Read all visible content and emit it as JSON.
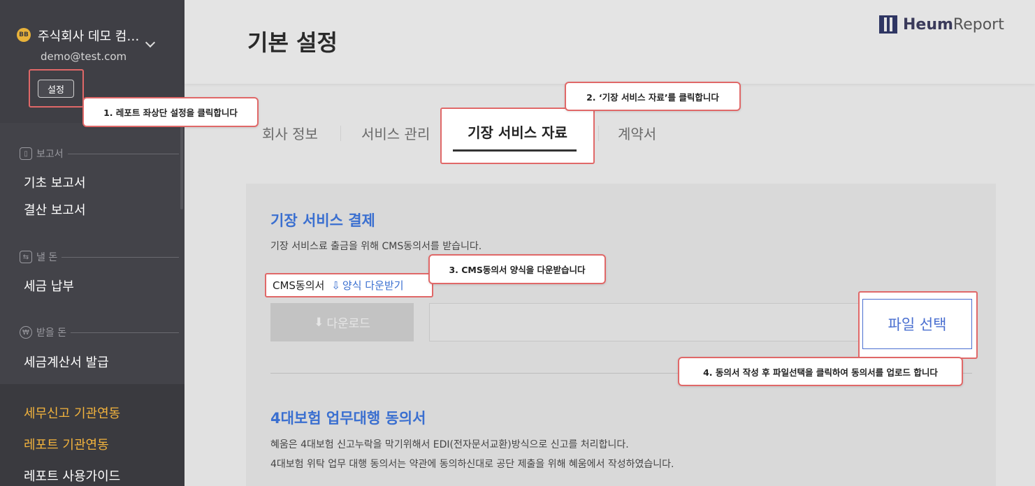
{
  "sidebar": {
    "logo_text": "BB",
    "company_name": "주식회사 데모 컴…",
    "email": "demo@test.com",
    "settings_label": "설정",
    "sections": [
      {
        "title": "보고서",
        "icon": "report-icon",
        "items": [
          "기초 보고서",
          "결산 보고서"
        ]
      },
      {
        "title": "낼 돈",
        "icon": "transfer-icon",
        "items": [
          "세금 납부"
        ]
      },
      {
        "title": "받을 돈",
        "icon": "won-coin-icon",
        "items": [
          "세금계산서 발급"
        ]
      }
    ],
    "bottom_links": [
      "세무신고 기관연동",
      "레포트 기관연동",
      "레포트 사용가이드"
    ]
  },
  "header": {
    "title": "기본 설정",
    "brand_name_bold": "Heum",
    "brand_name_light": "Report"
  },
  "tabs": [
    {
      "label": "회사 정보",
      "active": false
    },
    {
      "label": "서비스 관리",
      "active": false
    },
    {
      "label": "기장 서비스 자료",
      "active": true
    },
    {
      "label": "계약서",
      "active": false
    }
  ],
  "content": {
    "section1": {
      "title": "기장 서비스 결제",
      "description": "기장 서비스료 출금을 위해 CMS동의서를 받습니다.",
      "doc_label": "CMS동의서",
      "template_download": "양식 다운받기",
      "download_button": "다운로드",
      "file_select_button": "파일 선택"
    },
    "section2": {
      "title": "4대보험 업무대행 동의서",
      "line1": "혜움은 4대보험 신고누락을 막기위해서 EDI(전자문서교환)방식으로 신고를 처리합니다.",
      "line2": "4대보험 위탁 업무 대행 동의서는 약관에 동의하신대로 공단 제출을 위해 혜움에서 작성하였습니다."
    }
  },
  "callouts": {
    "step1": "1. 레포트 좌상단 설정을 클릭합니다",
    "step2": "2. ‘기장 서비스 자료’를 클릭합니다",
    "step3": "3. CMS동의서 양식을 다운받습니다",
    "step4": "4. 동의서 작성 후 파일선택을 클릭하여 동의서를 업로드 합니다"
  },
  "colors": {
    "accent_blue": "#3a6fd0",
    "highlight_red": "#e06868",
    "sidebar_bg": "#434349",
    "gold_link": "#f2b33d"
  }
}
